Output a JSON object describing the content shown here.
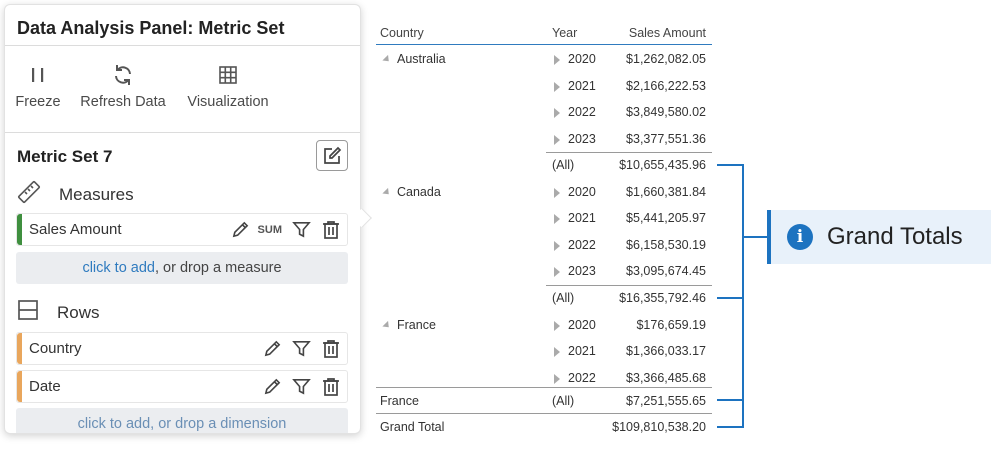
{
  "panel": {
    "title": "Data Analysis Panel: Metric Set",
    "toolbar": [
      {
        "label": "Freeze",
        "icon": "pause-icon"
      },
      {
        "label": "Refresh Data",
        "icon": "refresh-icon"
      },
      {
        "label": "Visualization",
        "icon": "grid-icon"
      }
    ],
    "metric_set_name": "Metric Set 7",
    "measures": {
      "label": "Measures",
      "items": [
        {
          "label": "Sales Amount",
          "aggregation": "SUM",
          "color": "#3f8f3f"
        }
      ],
      "dropzone_link": "click to add",
      "dropzone_rest": ", or drop a measure"
    },
    "rows": {
      "label": "Rows",
      "items": [
        {
          "label": "Country",
          "color": "#e9a65c"
        },
        {
          "label": "Date",
          "color": "#e9a65c"
        }
      ],
      "dropzone_partial": "click to add, or drop a dimension"
    }
  },
  "table": {
    "headers": {
      "country": "Country",
      "year": "Year",
      "sales": "Sales Amount"
    },
    "groups": [
      {
        "country": "Australia",
        "rows": [
          {
            "year": "2020",
            "value": "$1,262,082.05"
          },
          {
            "year": "2021",
            "value": "$2,166,222.53"
          },
          {
            "year": "2022",
            "value": "$3,849,580.02"
          },
          {
            "year": "2023",
            "value": "$3,377,551.36"
          }
        ],
        "subtotal_label": "(All)",
        "subtotal_value": "$10,655,435.96"
      },
      {
        "country": "Canada",
        "rows": [
          {
            "year": "2020",
            "value": "$1,660,381.84"
          },
          {
            "year": "2021",
            "value": "$5,441,205.97"
          },
          {
            "year": "2022",
            "value": "$6,158,530.19"
          },
          {
            "year": "2023",
            "value": "$3,095,674.45"
          }
        ],
        "subtotal_label": "(All)",
        "subtotal_value": "$16,355,792.46"
      },
      {
        "country": "France",
        "rows": [
          {
            "year": "2020",
            "value": "$176,659.19"
          },
          {
            "year": "2021",
            "value": "$1,366,033.17"
          },
          {
            "year": "2022",
            "value": "$3,366,485.68"
          }
        ]
      }
    ],
    "frozen_total": {
      "country": "France",
      "label": "(All)",
      "value": "$7,251,555.65"
    },
    "grand_total": {
      "label": "Grand Total",
      "value": "$109,810,538.20"
    }
  },
  "callout": {
    "text": "Grand Totals",
    "icon": "info-icon",
    "color": "#1d73c0"
  }
}
